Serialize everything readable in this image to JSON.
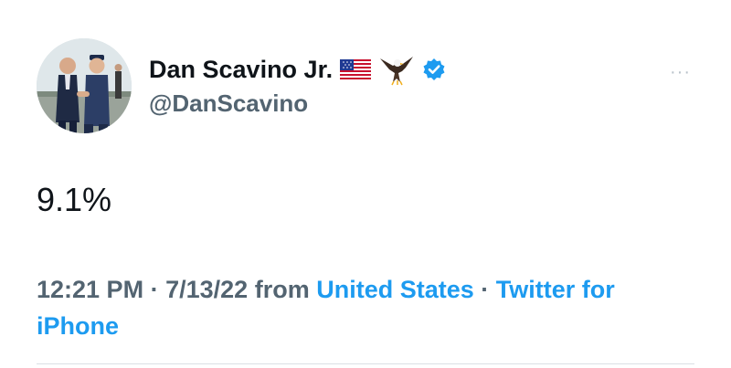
{
  "author": {
    "display_name": "Dan Scavino Jr.",
    "handle": "@DanScavino",
    "name_icons": [
      "us-flag-icon",
      "eagle-icon",
      "verified-badge-icon"
    ]
  },
  "tweet": {
    "text": "9.1%",
    "time": "12:21 PM",
    "separator": "·",
    "date": "7/13/22",
    "from_label": "from",
    "location": "United States",
    "source": "Twitter for iPhone"
  },
  "more_label": "···",
  "colors": {
    "text": "#0f1419",
    "secondary": "#536471",
    "link": "#1d9bf0",
    "verified": "#1d9bf0"
  }
}
